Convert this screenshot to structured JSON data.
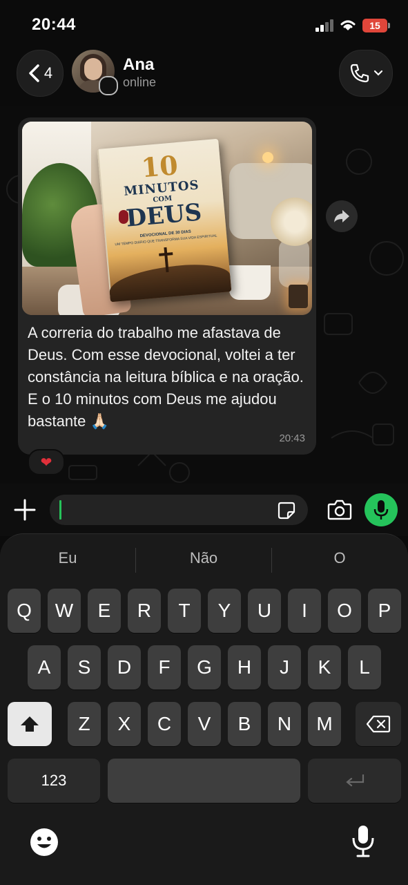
{
  "status_bar": {
    "time": "20:44",
    "battery": "15"
  },
  "header": {
    "back_count": "4",
    "contact_name": "Ana",
    "contact_status": "online"
  },
  "book": {
    "number": "10",
    "line1": "MINUTOS",
    "line2": "COM",
    "line3": "DEUS",
    "subtitle": "DEVOCIONAL DE 30 DIAS",
    "tagline": "UM TEMPO DIÁRIO QUE TRANSFORMA SUA VIDA ESPIRITUAL"
  },
  "message": {
    "text": "A correria do trabalho me afastava de Deus. Com esse devocional, voltei a ter constância na leitura bíblica e na oração. E o 10 minutos com Deus me ajudou bastante 🙏🏻",
    "time": "20:43",
    "reaction": "❤"
  },
  "keyboard": {
    "suggestions": [
      "Eu",
      "Não",
      "O"
    ],
    "row1": [
      "Q",
      "W",
      "E",
      "R",
      "T",
      "Y",
      "U",
      "I",
      "O",
      "P"
    ],
    "row2": [
      "A",
      "S",
      "D",
      "F",
      "G",
      "H",
      "J",
      "K",
      "L"
    ],
    "row3": [
      "Z",
      "X",
      "C",
      "V",
      "B",
      "N",
      "M"
    ],
    "numbers_label": "123"
  },
  "icons": {
    "back": "chevron-left-icon",
    "call": "phone-icon",
    "forward": "forward-icon",
    "plus": "plus-icon",
    "sticker": "sticker-icon",
    "camera": "camera-icon",
    "mic": "microphone-icon",
    "shift": "shift-icon",
    "delete": "backspace-icon",
    "return": "return-icon",
    "emoji": "emoji-icon",
    "dictation": "dictation-icon"
  },
  "colors": {
    "accent_green": "#25c35b",
    "battery_low": "#e0463a",
    "bubble": "#242424"
  }
}
